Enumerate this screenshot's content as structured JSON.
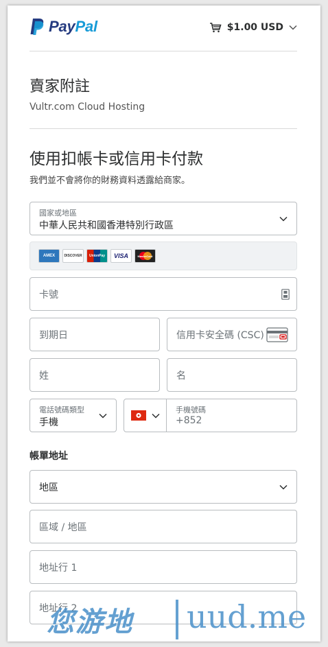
{
  "header": {
    "logo_pay": "Pay",
    "logo_pal": "Pal",
    "cart_amount": "$1.00 USD"
  },
  "seller_notes": {
    "title": "賣家附註",
    "text": "Vultr.com Cloud Hosting"
  },
  "payment": {
    "title": "使用扣帳卡或信用卡付款",
    "subtitle": "我們並不會將你的財務資料透露給商家。",
    "country_label": "國家或地區",
    "country_value": "中華人民共和國香港特別行政區",
    "card_brands": [
      {
        "name": "AMEX",
        "short": "AMEX"
      },
      {
        "name": "Discover",
        "short": "DISCOVER"
      },
      {
        "name": "UnionPay",
        "short": "UnionPay"
      },
      {
        "name": "Visa",
        "short": "VISA"
      },
      {
        "name": "MasterCard",
        "short": "MasterCard"
      }
    ],
    "card_number_placeholder": "卡號",
    "expiry_placeholder": "到期日",
    "csc_placeholder": "信用卡安全碼 (CSC)",
    "last_name_placeholder": "姓",
    "first_name_placeholder": "名",
    "phone_type_label": "電話號碼類型",
    "phone_type_value": "手機",
    "phone_label": "手機號碼",
    "phone_prefix": "+852"
  },
  "billing": {
    "title": "帳單地址",
    "region_value": "地區",
    "area_placeholder": "區域 / 地區",
    "address1_placeholder": "地址行 1",
    "address2_placeholder": "地址行 2"
  },
  "watermark": {
    "brand_cn": "您游地",
    "brand_url": "uud.me"
  },
  "colors": {
    "paypal_dark": "#253b80",
    "paypal_light": "#179bd7",
    "watermark": "#4a90c9"
  }
}
